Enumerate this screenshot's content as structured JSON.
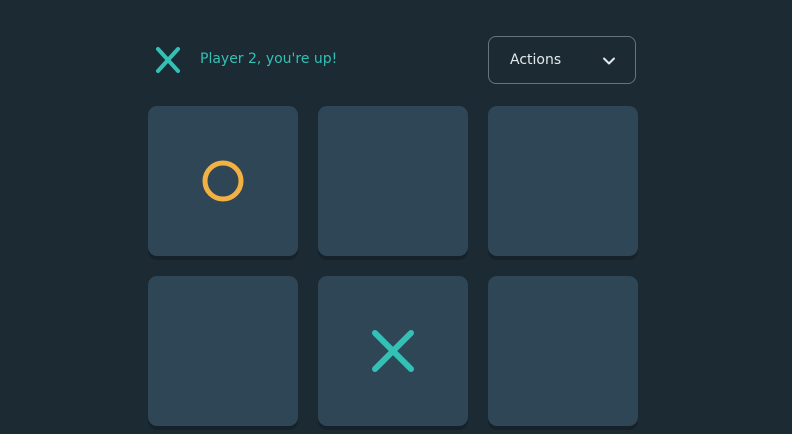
{
  "header": {
    "turn_mark": "X",
    "turn_icon": "x-mark-icon",
    "turn_text": "Player 2, you're up!",
    "actions_label": "Actions",
    "actions_icon": "chevron-down-icon"
  },
  "board": {
    "cells": [
      "O",
      "",
      "",
      "",
      "X",
      ""
    ]
  },
  "colors": {
    "background": "#1b2a33",
    "cell": "#2e4656",
    "x_mark": "#33c0b5",
    "o_mark": "#f2b142",
    "text_accent": "#33c0b5"
  }
}
